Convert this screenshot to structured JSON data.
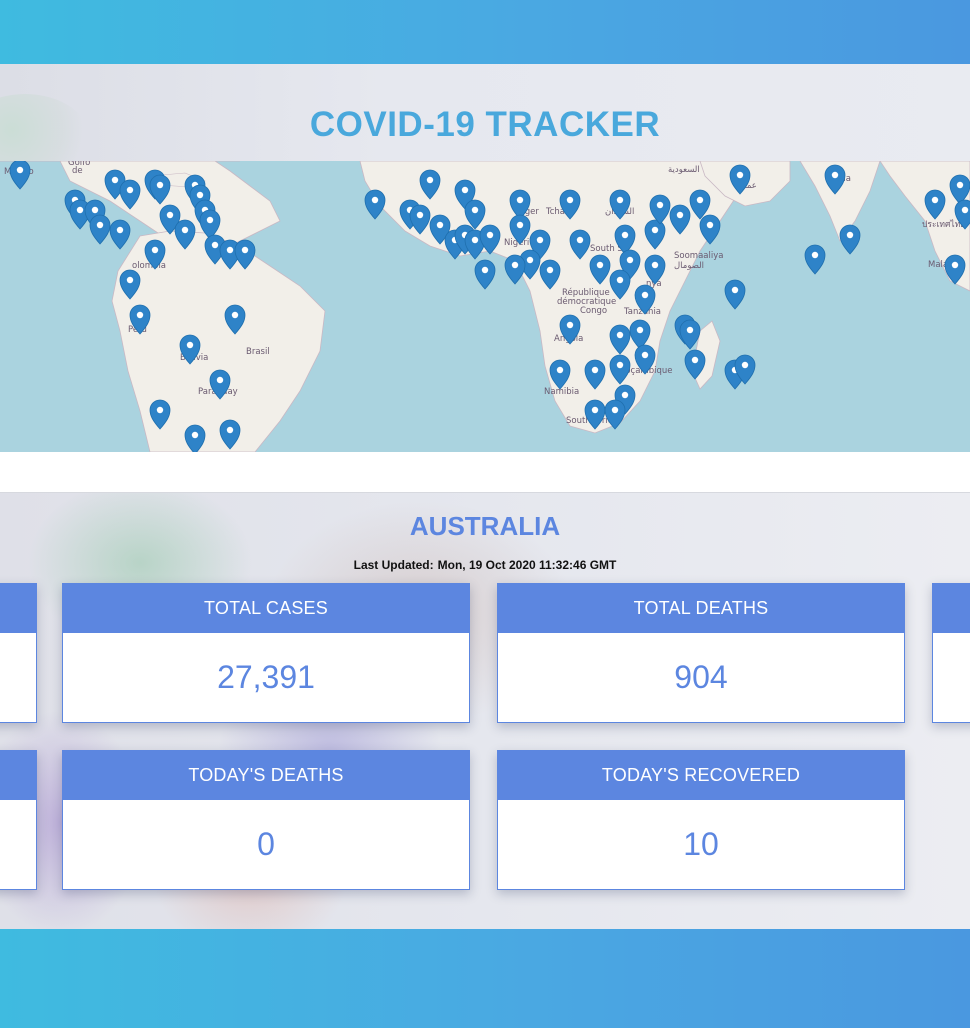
{
  "app": {
    "title": "COVID-19 TRACKER"
  },
  "map": {
    "labels": [
      {
        "text": "México"
      },
      {
        "text": "Golfo"
      },
      {
        "text": "de"
      },
      {
        "text": "olombia"
      },
      {
        "text": "Perú"
      },
      {
        "text": "Bolivia"
      },
      {
        "text": "Brasil"
      },
      {
        "text": "Paraguay"
      },
      {
        "text": "Tchad"
      },
      {
        "text": "Niger"
      },
      {
        "text": "Nigeri"
      },
      {
        "text": "South Su"
      },
      {
        "text": "Soomaaliya"
      },
      {
        "text": "الصومال"
      },
      {
        "text": "République"
      },
      {
        "text": "démocratique"
      },
      {
        "text": "Congo"
      },
      {
        "text": "Tanzania"
      },
      {
        "text": "Angola"
      },
      {
        "text": "Moçambique"
      },
      {
        "text": "Namibia"
      },
      {
        "text": "South Africa"
      },
      {
        "text": "السعودية"
      },
      {
        "text": "عمان"
      },
      {
        "text": "dia"
      },
      {
        "text": "ประเทศไทย"
      },
      {
        "text": "Malay"
      },
      {
        "text": "nya"
      },
      {
        "text": "السودان"
      }
    ],
    "marker_color": "#2e83c8",
    "water_color": "#aad3df",
    "land_color": "#f2efe9"
  },
  "country": {
    "name": "AUSTRALIA",
    "updated_label": "Last Updated:",
    "updated_value": "Mon, 19 Oct 2020 11:32:46 GMT"
  },
  "cards": {
    "total_cases": {
      "label": "TOTAL CASES",
      "value": "27,391"
    },
    "total_deaths": {
      "label": "TOTAL DEATHS",
      "value": "904"
    },
    "todays_deaths": {
      "label": "TODAY'S DEATHS",
      "value": "0"
    },
    "todays_recovered": {
      "label": "TODAY'S RECOVERED",
      "value": "10"
    }
  },
  "colors": {
    "accent": "#5c86e0",
    "title": "#49a8dc",
    "band": "#4aa8e2"
  }
}
